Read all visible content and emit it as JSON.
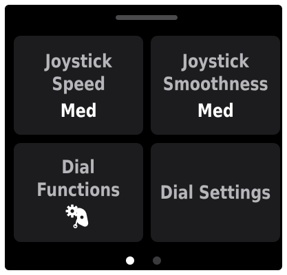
{
  "tiles": {
    "joystick_speed": {
      "line1": "Joystick",
      "line2": "Speed",
      "value": "Med"
    },
    "joystick_smoothness": {
      "line1": "Joystick",
      "line2": "Smoothness",
      "value": "Med"
    },
    "dial_functions": {
      "line1": "Dial",
      "line2": "Functions",
      "icon": "dial-gear-icon"
    },
    "dial_settings": {
      "label": "Dial Settings"
    }
  },
  "pagination": {
    "page_count": 2,
    "current_page": 1
  },
  "colors": {
    "background": "#000000",
    "tile": "#1c1c1e",
    "label": "#b6b6ba",
    "value": "#ffffff",
    "dot_active": "#ffffff",
    "dot_inactive": "#3a3a3c"
  }
}
